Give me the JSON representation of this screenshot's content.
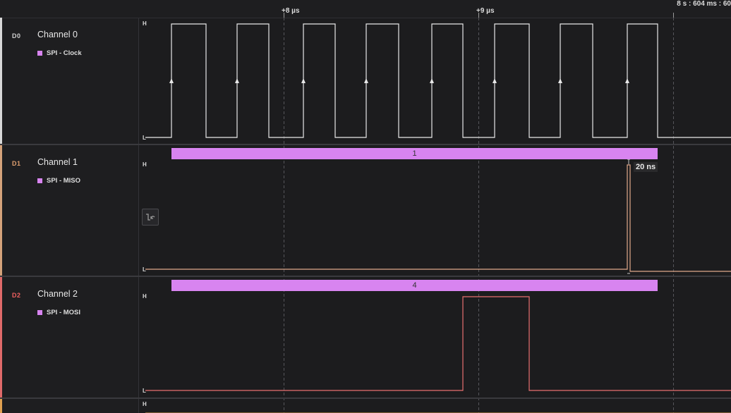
{
  "timeline": {
    "ticks": [
      "+8 µs",
      "+9 µs"
    ],
    "timestamp": "8 s : 604 ms : 60"
  },
  "channels": [
    {
      "id": "D0",
      "name": "Channel 0",
      "analyzer": "SPI - Clock",
      "color": "#d8d8d8",
      "label_color": "#cfcfcf"
    },
    {
      "id": "D1",
      "name": "Channel 1",
      "analyzer": "SPI - MISO",
      "color": "#d4a27a",
      "label_color": "#e0a070"
    },
    {
      "id": "D2",
      "name": "Channel 2",
      "analyzer": "SPI - MOSI",
      "color": "#e06a6a",
      "label_color": "#f06060"
    }
  ],
  "level_labels": {
    "high": "H",
    "low": "L"
  },
  "decodes": [
    {
      "channel": "D1",
      "value": "1"
    },
    {
      "channel": "D2",
      "value": "4"
    }
  ],
  "measurement": "20 ns",
  "colors": {
    "analyzer": "#d884f0",
    "background": "#1c1c1e",
    "grid": "#4a4a4e"
  },
  "icons": {
    "trigger": "trigger-edge-icon"
  }
}
